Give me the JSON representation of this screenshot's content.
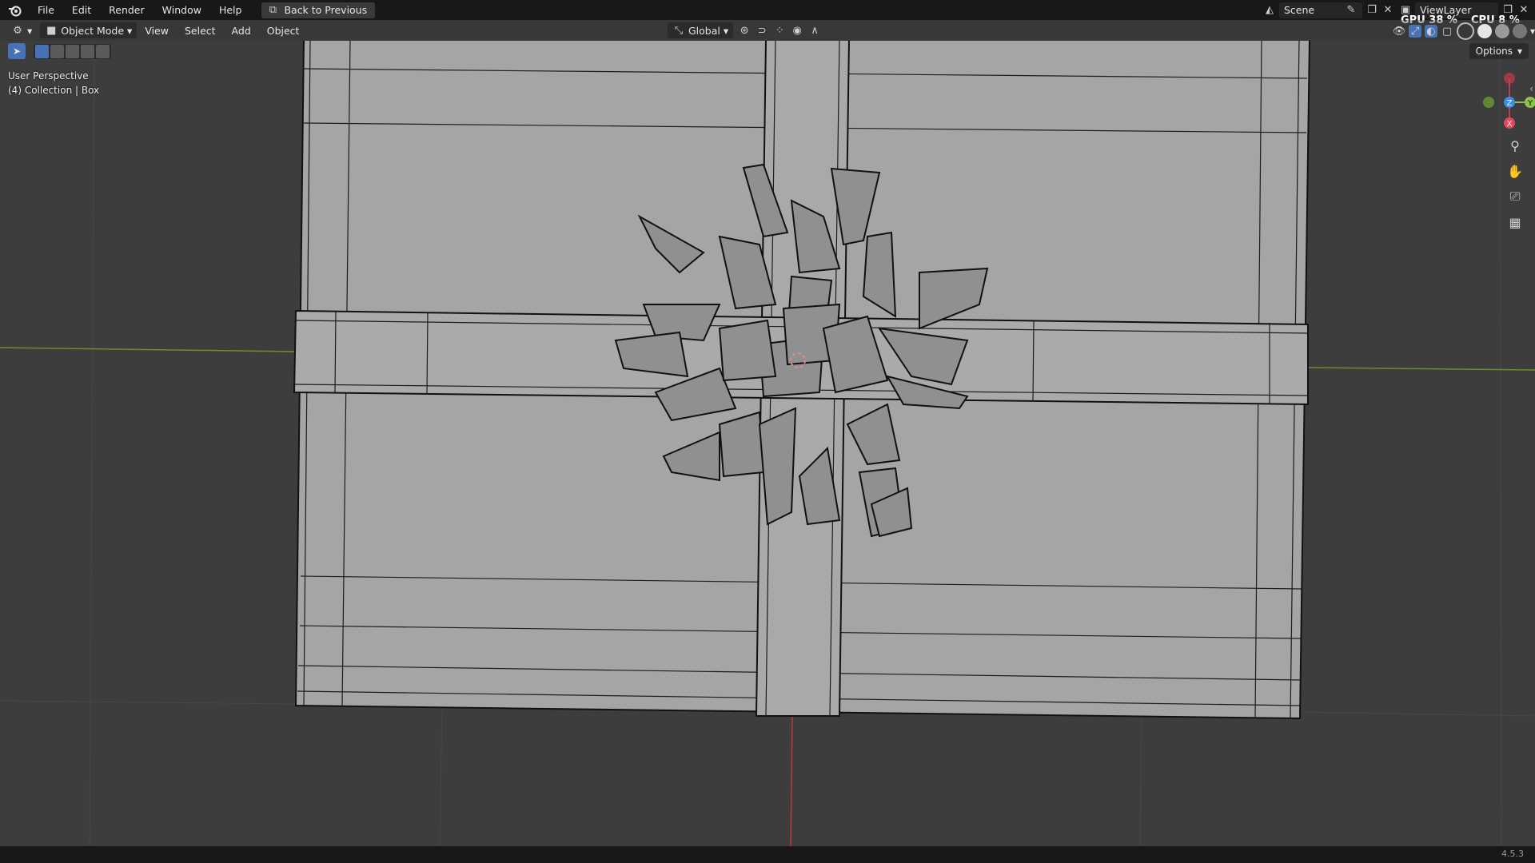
{
  "topbar": {
    "menus": [
      "File",
      "Edit",
      "Render",
      "Window",
      "Help"
    ],
    "back_label": "Back to Previous",
    "scene_label": "Scene",
    "viewlayer_label": "ViewLayer",
    "gpu_label": "GPU",
    "gpu_value": "38 %",
    "cpu_label": "CPU",
    "cpu_value": "8 %"
  },
  "header": {
    "mode_label": "Object Mode",
    "menus": [
      "View",
      "Select",
      "Add",
      "Object"
    ],
    "transform_orientation": "Global",
    "options_label": "Options"
  },
  "viewport": {
    "perspective_label": "User Perspective",
    "collection_label": "(4) Collection | Box"
  },
  "gizmo": {
    "axis_z": "Z",
    "axis_y": "Y",
    "axis_x": "X"
  },
  "nav_icons": [
    "zoom-icon",
    "hand-pan-icon",
    "camera-icon",
    "grid-ortho-icon"
  ],
  "colors": {
    "topbar_bg": "#181818",
    "viewport_bg": "#3d3d3d",
    "accent_blue": "#4772b3",
    "axis_x": "#e8445a",
    "axis_y": "#8bc34a",
    "axis_z": "#3b8de6"
  },
  "status": {
    "version": "4.5.3"
  }
}
